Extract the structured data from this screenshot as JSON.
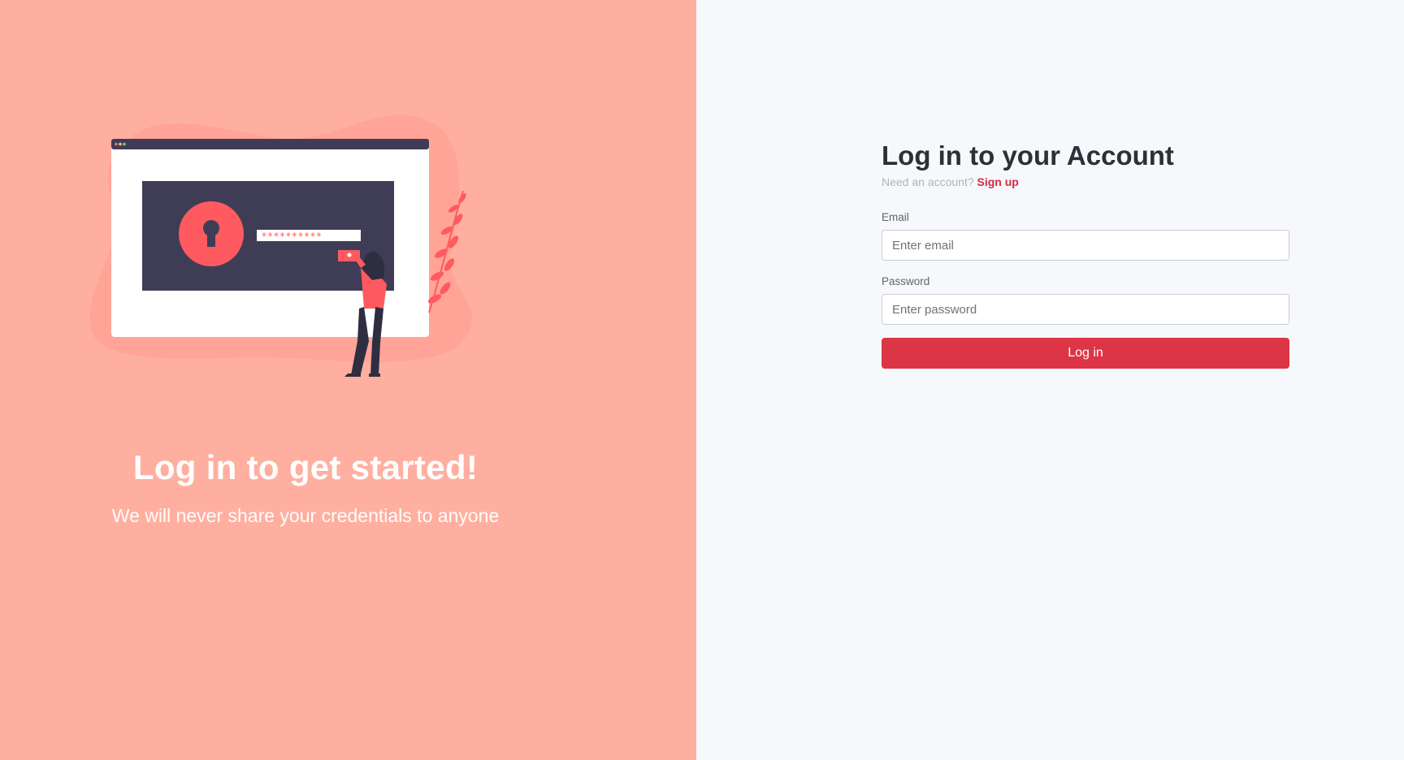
{
  "hero": {
    "title": "Log in to get started!",
    "subtitle": "We will never share your credentials to anyone"
  },
  "illustration": {
    "password_mask": "**********",
    "icons": [
      "lock-keyhole-icon",
      "browser-window-icon",
      "person-figure-icon",
      "plant-leaf-icon"
    ]
  },
  "form": {
    "title": "Log in to your Account",
    "signup_prompt": "Need an account?",
    "signup_link": "Sign up",
    "email_label": "Email",
    "email_placeholder": "Enter email",
    "password_label": "Password",
    "password_placeholder": "Enter password",
    "submit_label": "Log in"
  },
  "colors": {
    "left_background": "#ffafa0",
    "right_background": "#f7f8fc",
    "accent": "#dc3545",
    "link": "#d2293f",
    "illustration_dark": "#3f3d56",
    "illustration_red": "#ff5a5f"
  }
}
